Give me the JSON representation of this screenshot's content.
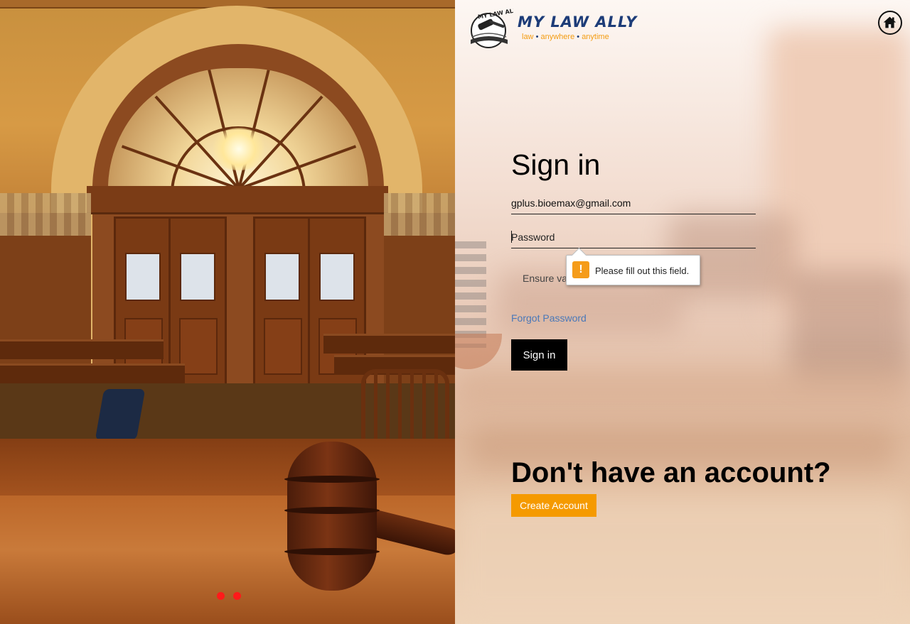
{
  "hero": {
    "carousel_dots": [
      {
        "active": true
      },
      {
        "active": false
      }
    ],
    "dot_color": "#ff1a1a"
  },
  "logo": {
    "name": "MY LAW ALLY",
    "emblem_text": "MY LAW ALLY",
    "tagline": [
      "law",
      "anywhere",
      "anytime"
    ],
    "separator": "•",
    "brand_color": "#1d3c78",
    "accent_color": "#f39c12"
  },
  "header": {
    "home_icon": "home-icon"
  },
  "signin": {
    "title": "Sign in",
    "email_value": "gplus.bioemax@gmail.com",
    "password_placeholder": "Password",
    "hint_text": "Ensure va",
    "validation_message": "Please fill out this field.",
    "validation_icon": "warning-icon",
    "forgot_label": "Forgot Password",
    "submit_label": "Sign in"
  },
  "signup": {
    "heading": "Don't have an account?",
    "button_label": "Create Account",
    "button_color": "#f59a00"
  }
}
